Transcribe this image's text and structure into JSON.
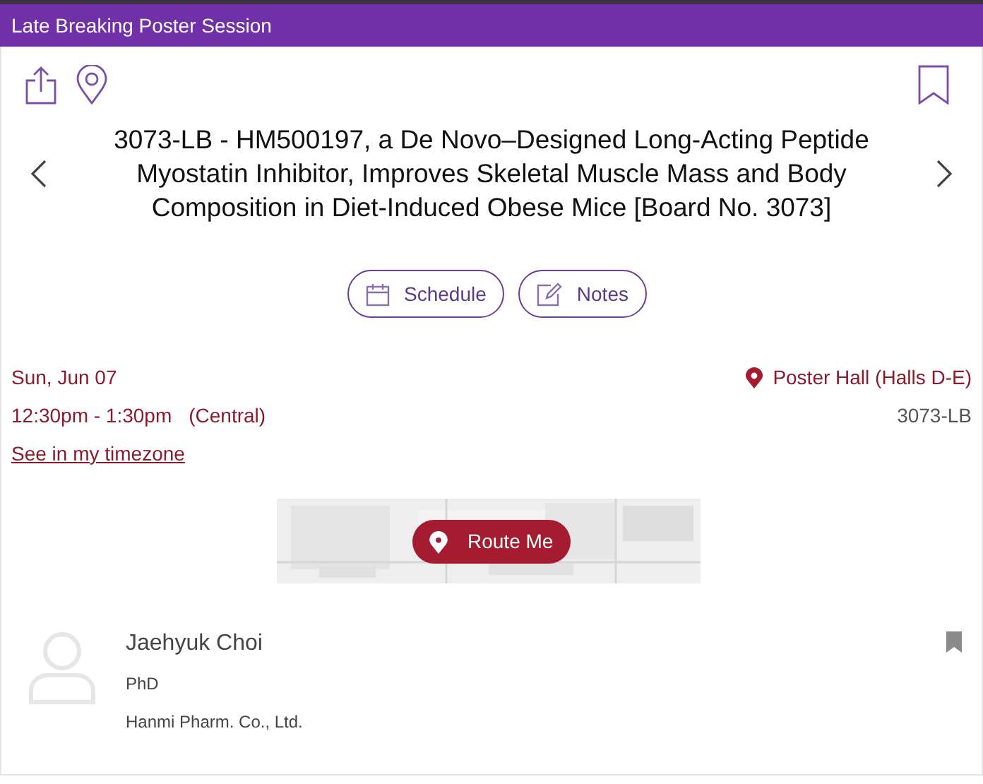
{
  "header": {
    "title": "Late Breaking Poster Session"
  },
  "session": {
    "title": "3073-LB - HM500197, a De Novo–Designed Long-Acting Peptide Myostatin Inhibitor, Improves Skeletal Muscle Mass and Body Composition in Diet-Induced Obese Mice [Board No. 3073]"
  },
  "actions": [
    {
      "kind": "schedule",
      "label": "Schedule"
    },
    {
      "kind": "notes",
      "label": "Notes"
    }
  ],
  "details": {
    "date": "Sun, Jun 07",
    "time": "12:30pm - 1:30pm",
    "timezone": "(Central)",
    "timezone_link": "See in my timezone",
    "location": "Poster Hall (Halls D-E)",
    "code": "3073-LB"
  },
  "map": {
    "button": "Route Me"
  },
  "speakers": [
    {
      "name": "Jaehyuk Choi",
      "degree": "PhD",
      "affiliation": "Hanmi Pharm. Co., Ltd."
    }
  ]
}
